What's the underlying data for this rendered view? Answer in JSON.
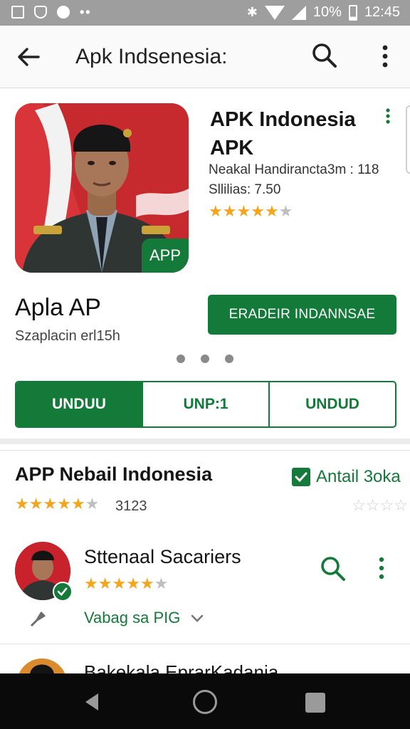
{
  "status_bar": {
    "battery": "10%",
    "time": "12:45"
  },
  "toolbar": {
    "title": "Apk Indsenesia:"
  },
  "app_card": {
    "name": "APK Indonesia APK",
    "meta_line1": "Neakal Handirancta3m : 118",
    "meta_line2": "Sllilias: 7.50",
    "rating_stars": 4.5,
    "icon_badge": "APP",
    "subtitle": "Apla AP",
    "caption": "Szaplacin erl15h",
    "install_label": "ERADEIR INDANNSAE",
    "pager_dots": 3,
    "segments": [
      "UNDUU",
      "UNP:1",
      "UNDUD"
    ]
  },
  "section2": {
    "title": "APP Nebail Indonesia",
    "check_label": "Antail 3oka",
    "rating_stars": 4.5,
    "count": "3123",
    "items": [
      {
        "title": "Sttenaal Sacariers",
        "rating_stars": 4.5,
        "link": "Vabag sa PIG"
      },
      {
        "title": "Bakekala EprarKadania"
      }
    ]
  },
  "colors": {
    "brand_green": "#137a3a",
    "star": "#f5a51c",
    "status_bar": "#9e9e9e"
  }
}
